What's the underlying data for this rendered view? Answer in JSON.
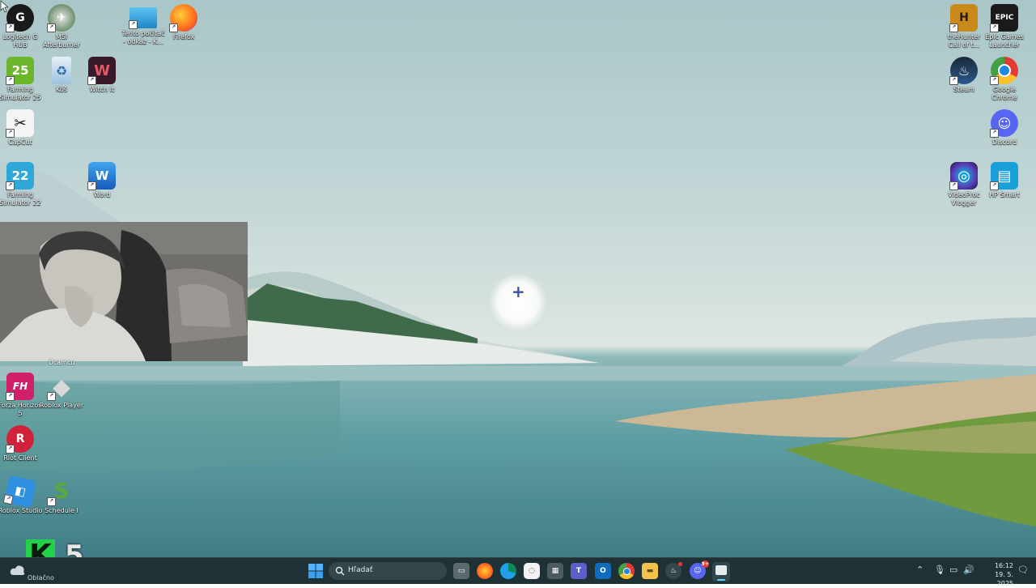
{
  "desktop": {
    "icons_left": [
      {
        "id": "logitech",
        "label": "Logitech G HUB",
        "color": "#1a1a1a",
        "glyph": "G"
      },
      {
        "id": "msi",
        "label": "MSI Afterburner",
        "color": "#3a6b3a",
        "glyph": "✈"
      },
      {
        "id": "pc",
        "label": "Tento počítač - odkaz - K...",
        "color": "#2f9fd8",
        "glyph": ""
      },
      {
        "id": "firefox",
        "label": "Firefox",
        "color": "#ff7139",
        "glyph": "🦊"
      },
      {
        "id": "fs25",
        "label": "Farming Simulator 25",
        "color": "#6bb62b",
        "glyph": "25"
      },
      {
        "id": "trash",
        "label": "Kôš",
        "color": "#b8d4e8",
        "glyph": "♻"
      },
      {
        "id": "witchit",
        "label": "Witch It",
        "color": "#3a1a2a",
        "glyph": "W"
      },
      {
        "id": "capcut",
        "label": "CapCut",
        "color": "#f4f4f4",
        "glyph": "✂"
      },
      {
        "id": "fs22",
        "label": "Farming Simulator 22",
        "color": "#2fa8d8",
        "glyph": "22"
      },
      {
        "id": "word",
        "label": "Word",
        "color": "#2b5fb8",
        "glyph": "W"
      },
      {
        "id": "forza",
        "label": "Forza Horizon 5",
        "color": "#d0206a",
        "glyph": "FH"
      },
      {
        "id": "roblox",
        "label": "Roblox Player",
        "color": "#d8d8d8",
        "glyph": "◆"
      },
      {
        "id": "riot",
        "label": "Riot Client",
        "color": "#d0223a",
        "glyph": "R"
      },
      {
        "id": "robloxstudio",
        "label": "Roblox Studio",
        "color": "#2f8fe0",
        "glyph": "◧"
      },
      {
        "id": "schedule",
        "label": "Schedule I",
        "color": "#5fa63a",
        "glyph": "S"
      }
    ],
    "icons_right": [
      {
        "id": "thehunter",
        "label": "theHunter Call of t...",
        "color": "#c98a1a",
        "glyph": "H"
      },
      {
        "id": "epic",
        "label": "Epic Games Launcher",
        "color": "#1a1a1a",
        "glyph": "EPIC"
      },
      {
        "id": "steam",
        "label": "Steam",
        "color": "#1b2838",
        "glyph": "♨"
      },
      {
        "id": "chrome",
        "label": "Google Chrome",
        "color": "#e53935",
        "glyph": "◉"
      },
      {
        "id": "discord",
        "label": "Discord",
        "color": "#5865f2",
        "glyph": "☺"
      },
      {
        "id": "videoproc",
        "label": "VideoProc Vlogger",
        "color": "#5a3ab8",
        "glyph": "◎"
      },
      {
        "id": "hpsmart",
        "label": "HP Smart",
        "color": "#1aa0d8",
        "glyph": "▤"
      }
    ],
    "partial_hidden_label": "Ucamcu"
  },
  "overlay": {
    "stream_logo_letter": "K",
    "stream_logo_number": "5"
  },
  "taskbar": {
    "weather_label": "Oblačno",
    "search_placeholder": "Hľadať",
    "clock_time": "16:12",
    "clock_date": "19. 5. 2025",
    "discord_badge": "9+",
    "accent_color": "#5fd0ff"
  }
}
